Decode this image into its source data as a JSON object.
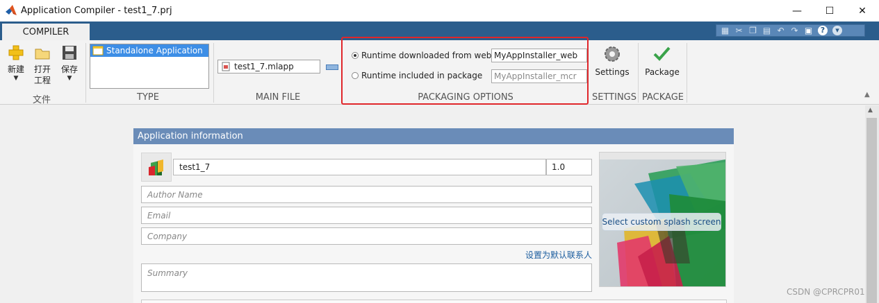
{
  "window": {
    "title": "Application Compiler - test1_7.prj",
    "minimize": "—",
    "maximize": "☐",
    "close": "✕"
  },
  "tabs": {
    "compiler": "COMPILER"
  },
  "quick_access_icons": [
    "save-icon",
    "cut-icon",
    "copy-icon",
    "paste-icon",
    "undo-icon",
    "redo-icon",
    "layout-icon",
    "help-icon",
    "options-icon"
  ],
  "ribbon": {
    "file": {
      "new_label": "新建",
      "open_label_1": "打开",
      "open_label_2": "工程",
      "save_label": "保存",
      "group_label": "文件"
    },
    "type": {
      "selected": "Standalone Application",
      "group_label": "TYPE"
    },
    "main_file": {
      "value": "test1_7.mlapp",
      "group_label": "MAIN FILE"
    },
    "packaging": {
      "option_web_label": "Runtime downloaded from web",
      "option_web_value": "MyAppInstaller_web",
      "option_package_label": "Runtime included in package",
      "option_package_placeholder": "MyAppInstaller_mcr",
      "selected": "web",
      "group_label": "PACKAGING OPTIONS"
    },
    "settings": {
      "label": "Settings",
      "group_label": "SETTINGS"
    },
    "package": {
      "label": "Package",
      "group_label": "PACKAGE"
    }
  },
  "app_info": {
    "header": "Application information",
    "app_name": "test1_7",
    "version": "1.0",
    "author_placeholder": "Author Name",
    "email_placeholder": "Email",
    "company_placeholder": "Company",
    "default_contact_link": "设置为默认联系人",
    "summary_placeholder": "Summary",
    "splash_button": "Select custom splash screen"
  },
  "watermark": "CSDN @CPRCPR01",
  "colors": {
    "tab_bar": "#2b5d8c",
    "panel_header": "#6a8cb8",
    "highlight": "#e0262a",
    "selection": "#3d8ee6"
  }
}
